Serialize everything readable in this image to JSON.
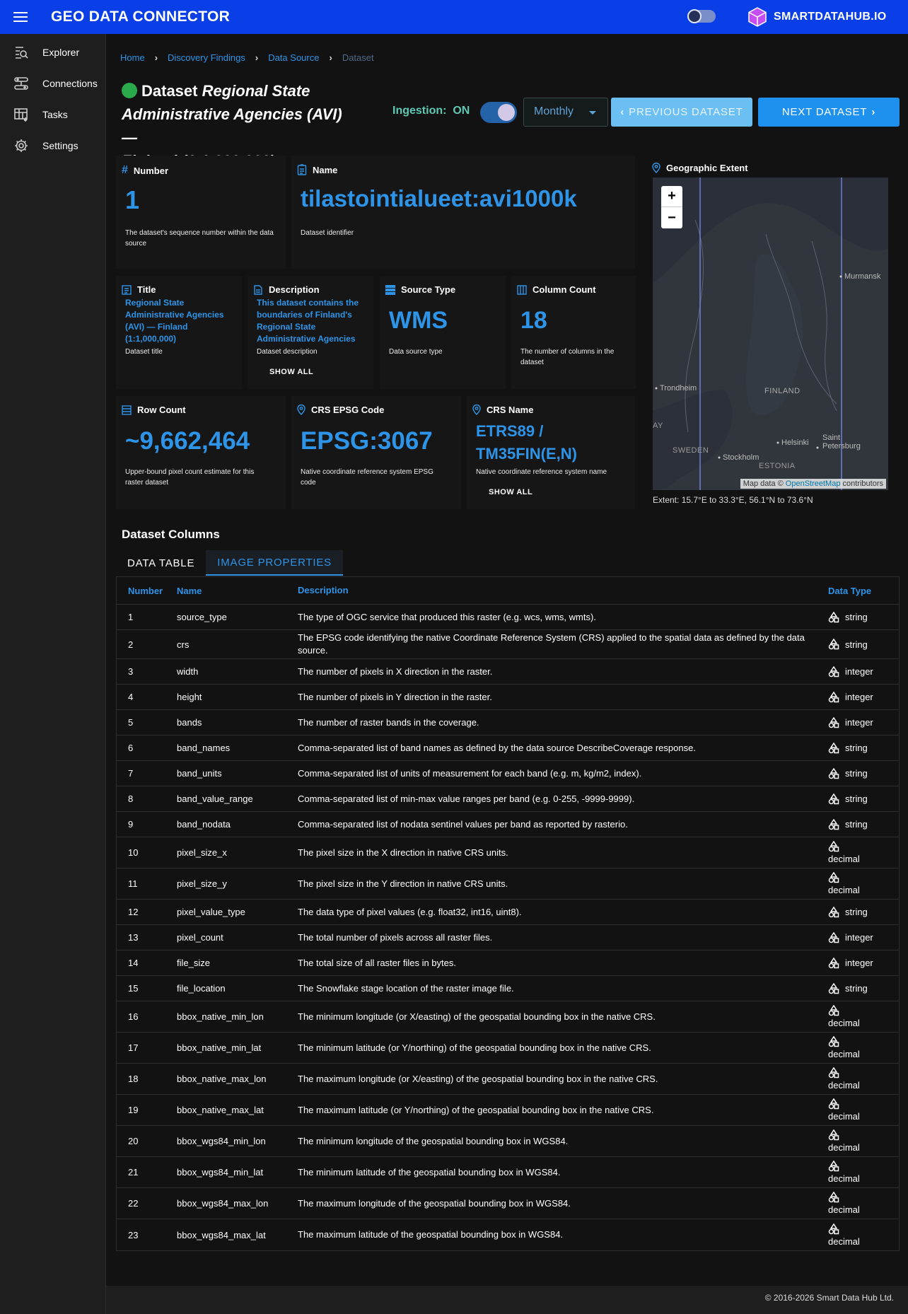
{
  "app": {
    "title": "GEO DATA CONNECTOR",
    "brand": "SMARTDATAHUB.IO"
  },
  "sidebar": {
    "items": [
      {
        "label": "Explorer",
        "icon": "explorer-icon"
      },
      {
        "label": "Connections",
        "icon": "connections-icon"
      },
      {
        "label": "Tasks",
        "icon": "tasks-icon"
      },
      {
        "label": "Settings",
        "icon": "gear-icon"
      }
    ]
  },
  "breadcrumb": [
    "Home",
    "Discovery Findings",
    "Data Source",
    "Dataset"
  ],
  "dataset": {
    "prefix": "Dataset",
    "title_line1": "Regional State",
    "title_line2": "Administrative Agencies (AVI) —",
    "title_line3": "Finland (1:1,000,000)",
    "status_color": "#2ba84a"
  },
  "controls": {
    "ingestion_label": "Ingestion:",
    "ingestion_state": "ON",
    "ingestion_enabled": true,
    "frequency": "Monthly",
    "prev_label": "PREVIOUS DATASET",
    "next_label": "NEXT DATASET"
  },
  "cards": {
    "number": {
      "label": "Number",
      "value": "1",
      "desc": "The dataset's sequence number within the data source"
    },
    "name": {
      "label": "Name",
      "value": "tilastointialueet:avi1000k",
      "desc": "Dataset identifier"
    },
    "title": {
      "label": "Title",
      "value": "Regional State Administrative Agencies (AVI) — Finland (1:1,000,000)",
      "desc": "Dataset title"
    },
    "description": {
      "label": "Description",
      "value": "This dataset contains the boundaries of Finland's Regional State Administrative Agencies",
      "desc": "Dataset description",
      "show_all": "SHOW ALL"
    },
    "source_type": {
      "label": "Source Type",
      "value": "WMS",
      "desc": "Data source type"
    },
    "column_count": {
      "label": "Column Count",
      "value": "18",
      "desc": "The number of columns in the dataset"
    },
    "row_count": {
      "label": "Row Count",
      "value": "~9,662,464",
      "desc": "Upper-bound pixel count estimate for this raster dataset"
    },
    "crs_code": {
      "label": "CRS EPSG Code",
      "value": "EPSG:3067",
      "desc": "Native coordinate reference system EPSG code"
    },
    "crs_name": {
      "label": "CRS Name",
      "value_line1": "ETRS89 /",
      "value_line2": "TM35FIN(E,N)",
      "desc": "Native coordinate reference system name",
      "show_all": "SHOW ALL"
    }
  },
  "map": {
    "label": "Geographic Extent",
    "zoom_in": "+",
    "zoom_out": "−",
    "attribution_prefix": "Map data ©",
    "attribution_link": "OpenStreetMap",
    "attribution_suffix": "contributors",
    "places": {
      "murmansk": "Murmansk",
      "trondheim": "Trondheim",
      "finland": "FINLAND",
      "helsinki": "Helsinki",
      "saint": "Saint",
      "petersburg": "Petersburg",
      "sweden": "SWEDEN",
      "stockholm": "Stockholm",
      "estonia": "ESTONIA",
      "ay": "AY"
    },
    "extent": "Extent: 15.7°E to 33.3°E, 56.1°N to 73.6°N"
  },
  "columns_section": {
    "title": "Dataset Columns",
    "tabs": [
      "DATA TABLE",
      "IMAGE PROPERTIES"
    ],
    "active_tab": 1,
    "headers": [
      "Number",
      "Name",
      "Description",
      "Data Type"
    ],
    "rows": [
      {
        "n": "1",
        "name": "source_type",
        "desc": "The type of OGC service that produced this raster (e.g. wcs, wms, wmts).",
        "type": "string"
      },
      {
        "n": "2",
        "name": "crs",
        "desc": "The EPSG code identifying the native Coordinate Reference System (CRS) applied to the spatial data as defined by the data source.",
        "type": "string"
      },
      {
        "n": "3",
        "name": "width",
        "desc": "The number of pixels in X direction in the raster.",
        "type": "integer"
      },
      {
        "n": "4",
        "name": "height",
        "desc": "The number of pixels in Y direction in the raster.",
        "type": "integer"
      },
      {
        "n": "5",
        "name": "bands",
        "desc": "The number of raster bands in the coverage.",
        "type": "integer"
      },
      {
        "n": "6",
        "name": "band_names",
        "desc": "Comma-separated list of band names as defined by the data source DescribeCoverage response.",
        "type": "string"
      },
      {
        "n": "7",
        "name": "band_units",
        "desc": "Comma-separated list of units of measurement for each band (e.g. m, kg/m2, index).",
        "type": "string"
      },
      {
        "n": "8",
        "name": "band_value_range",
        "desc": "Comma-separated list of min-max value ranges per band (e.g. 0-255, -9999-9999).",
        "type": "string"
      },
      {
        "n": "9",
        "name": "band_nodata",
        "desc": "Comma-separated list of nodata sentinel values per band as reported by rasterio.",
        "type": "string"
      },
      {
        "n": "10",
        "name": "pixel_size_x",
        "desc": "The pixel size in the X direction in native CRS units.",
        "type": "decimal"
      },
      {
        "n": "11",
        "name": "pixel_size_y",
        "desc": "The pixel size in the Y direction in native CRS units.",
        "type": "decimal"
      },
      {
        "n": "12",
        "name": "pixel_value_type",
        "desc": "The data type of pixel values (e.g. float32, int16, uint8).",
        "type": "string"
      },
      {
        "n": "13",
        "name": "pixel_count",
        "desc": "The total number of pixels across all raster files.",
        "type": "integer"
      },
      {
        "n": "14",
        "name": "file_size",
        "desc": "The total size of all raster files in bytes.",
        "type": "integer"
      },
      {
        "n": "15",
        "name": "file_location",
        "desc": "The Snowflake stage location of the raster image file.",
        "type": "string"
      },
      {
        "n": "16",
        "name": "bbox_native_min_lon",
        "desc": "The minimum longitude (or X/easting) of the geospatial bounding box in the native CRS.",
        "type": "decimal"
      },
      {
        "n": "17",
        "name": "bbox_native_min_lat",
        "desc": "The minimum latitude (or Y/northing) of the geospatial bounding box in the native CRS.",
        "type": "decimal"
      },
      {
        "n": "18",
        "name": "bbox_native_max_lon",
        "desc": "The maximum longitude (or X/easting) of the geospatial bounding box in the native CRS.",
        "type": "decimal"
      },
      {
        "n": "19",
        "name": "bbox_native_max_lat",
        "desc": "The maximum latitude (or Y/northing) of the geospatial bounding box in the native CRS.",
        "type": "decimal"
      },
      {
        "n": "20",
        "name": "bbox_wgs84_min_lon",
        "desc": "The minimum longitude of the geospatial bounding box in WGS84.",
        "type": "decimal"
      },
      {
        "n": "21",
        "name": "bbox_wgs84_min_lat",
        "desc": "The minimum latitude of the geospatial bounding box in WGS84.",
        "type": "decimal"
      },
      {
        "n": "22",
        "name": "bbox_wgs84_max_lon",
        "desc": "The maximum longitude of the geospatial bounding box in WGS84.",
        "type": "decimal"
      },
      {
        "n": "23",
        "name": "bbox_wgs84_max_lat",
        "desc": "The maximum latitude of the geospatial bounding box in WGS84.",
        "type": "decimal"
      }
    ]
  },
  "footer": {
    "text": "© 2016-2026 Smart Data Hub Ltd."
  }
}
